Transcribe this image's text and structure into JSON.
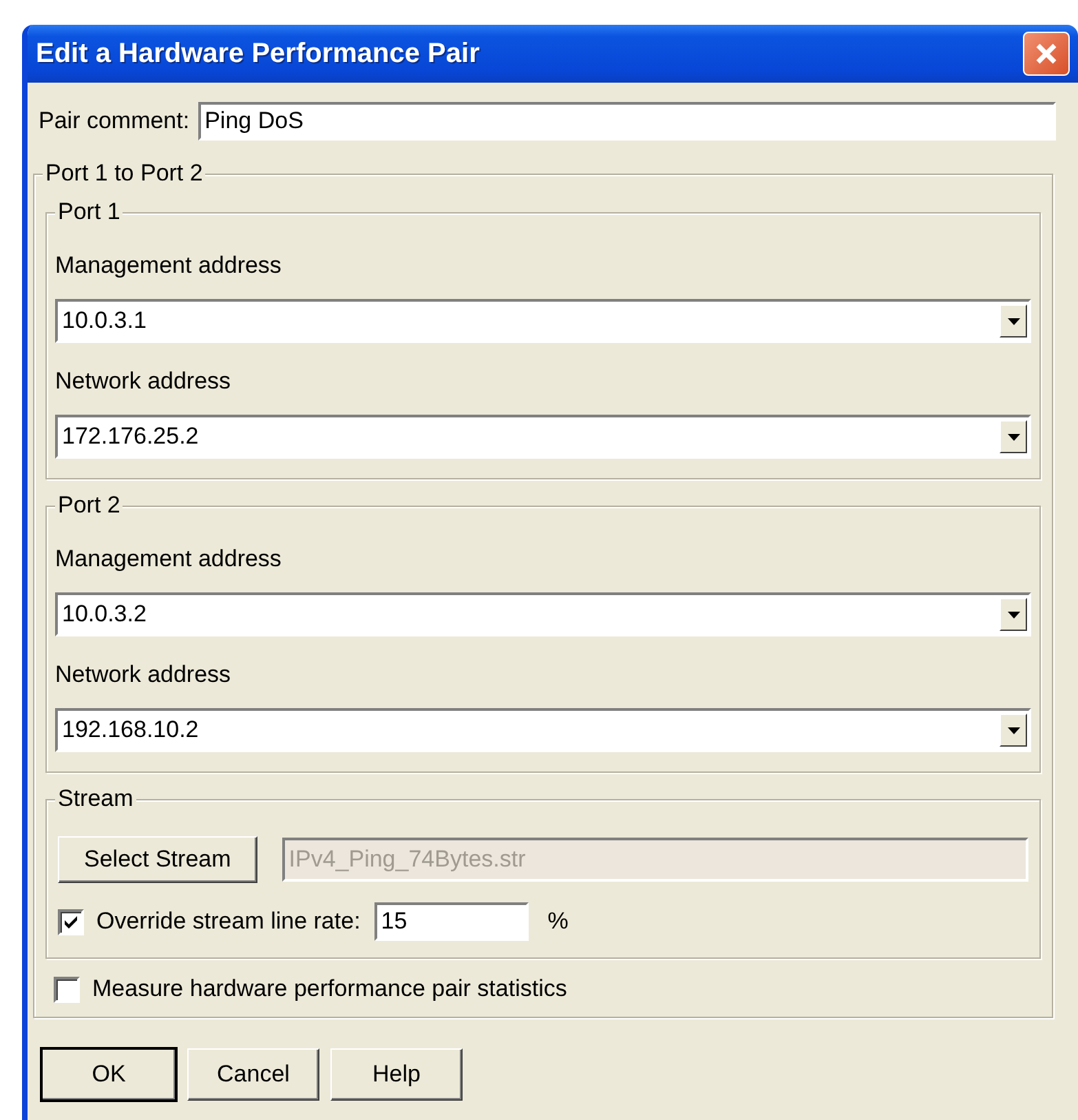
{
  "window": {
    "title": "Edit a Hardware Performance Pair"
  },
  "pair_comment": {
    "label": "Pair comment:",
    "value": "Ping DoS"
  },
  "connection": {
    "legend": "Port 1 to Port 2",
    "ports": [
      {
        "legend": "Port 1",
        "fields": [
          {
            "label": "Management address",
            "value": "10.0.3.1"
          },
          {
            "label": "Network address",
            "value": "172.176.25.2"
          }
        ]
      },
      {
        "legend": "Port 2",
        "fields": [
          {
            "label": "Management address",
            "value": "10.0.3.2"
          },
          {
            "label": "Network address",
            "value": "192.168.10.2"
          }
        ]
      }
    ],
    "stream": {
      "legend": "Stream",
      "button": "Select Stream",
      "file": {
        "value": "IPv4_Ping_74Bytes.str",
        "disabled": true
      },
      "override": {
        "label": "Override stream line rate:",
        "checked": true,
        "value": "15",
        "unit": "%"
      }
    },
    "measure": {
      "label": "Measure hardware performance pair statistics",
      "checked": false
    }
  },
  "buttons": [
    {
      "label": "OK",
      "default": true
    },
    {
      "label": "Cancel",
      "default": false
    },
    {
      "label": "Help",
      "default": false
    }
  ]
}
